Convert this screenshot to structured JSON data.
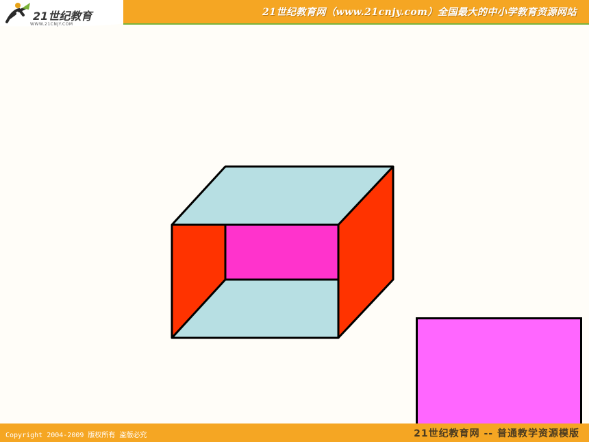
{
  "header": {
    "logo_text": "21世纪教育",
    "logo_url": "WWW.21CNJY.COM",
    "title": "21世纪教育网（www.21cnjy.com）全国最大的中小学教育资源网站"
  },
  "figure": {
    "colors": {
      "top_bottom": "#b7dfe3",
      "sides": "#ff3300",
      "back": "#ff33cc",
      "separate_face": "#ff66ff",
      "outline": "#000000"
    }
  },
  "footer": {
    "copyright": "Copyright 2004-2009 版权所有 盗版必究",
    "brand": "21世纪教育网  --  普通教学资源模版"
  }
}
